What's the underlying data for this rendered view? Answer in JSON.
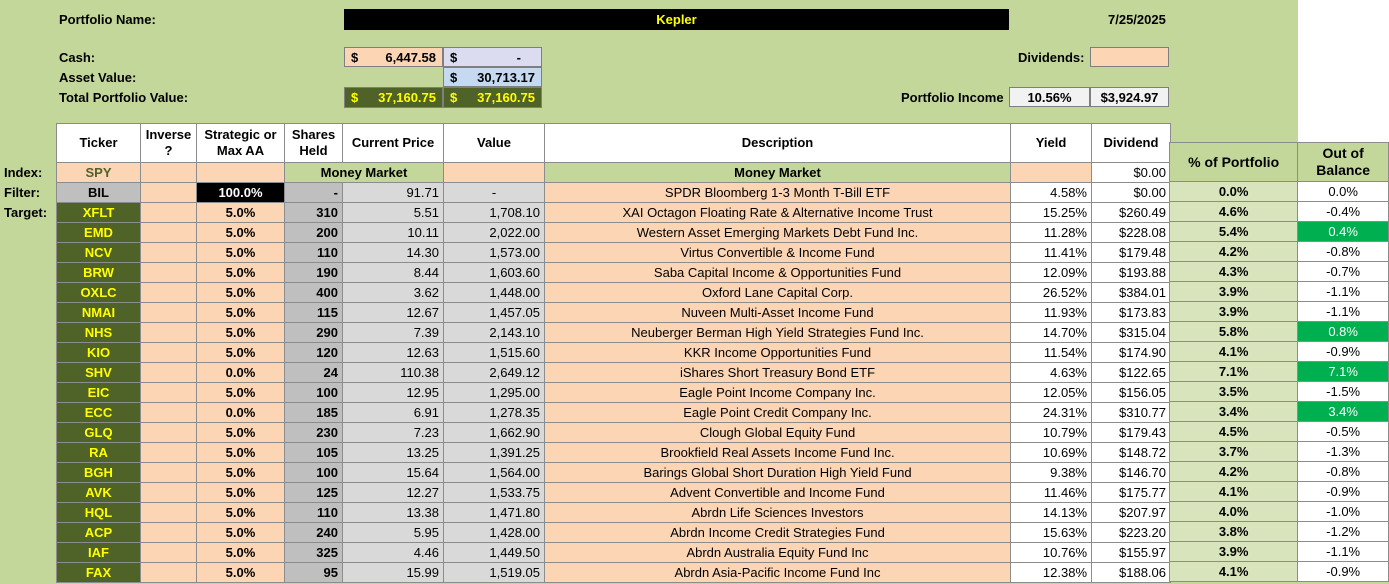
{
  "header": {
    "portfolio_name_label": "Portfolio Name:",
    "portfolio_name": "Kepler",
    "date": "7/25/2025",
    "cash_label": "Cash:",
    "cash_currency": "$",
    "cash_value": "6,447.58",
    "cash2_currency": "$",
    "cash2_value": "-",
    "asset_value_label": "Asset Value:",
    "asset_currency": "$",
    "asset_value": "30,713.17",
    "total_label": "Total Portfolio Value:",
    "total_currency": "$",
    "total_value": "37,160.75",
    "total2_currency": "$",
    "total2_value": "37,160.75",
    "dividends_label": "Dividends:",
    "dividends_value": "",
    "income_label": "Portfolio Income",
    "income_pct": "10.56%",
    "income_value": "$3,924.97"
  },
  "row_labels": {
    "index": "Index:",
    "filter": "Filter:",
    "target": "Target:"
  },
  "columns": [
    "Ticker",
    "Inverse ?",
    "Strategic or Max AA",
    "Shares Held",
    "Current Price",
    "Value",
    "Description",
    "Yield",
    "Dividend"
  ],
  "side_columns": [
    "% of Portfolio",
    "Out of Balance"
  ],
  "index_row": {
    "ticker": "SPY",
    "inverse": "",
    "aa": "",
    "shares": "Money Market",
    "price": "",
    "value": "",
    "description": "Money Market",
    "yield": "",
    "dividend": "$0.00"
  },
  "filter_row": {
    "ticker": "BIL",
    "inverse": "",
    "aa": "100.0%",
    "shares": "-",
    "price": "91.71",
    "value": "-",
    "description": "SPDR Bloomberg 1-3 Month T-Bill ETF",
    "yield": "4.58%",
    "dividend": "$0.00",
    "pct": "0.0%",
    "oob": "0.0%"
  },
  "rows": [
    {
      "ticker": "XFLT",
      "inverse": "",
      "aa": "5.0%",
      "shares": "310",
      "price": "5.51",
      "value": "1,708.10",
      "description": "XAI Octagon Floating Rate & Alternative Income Trust",
      "yield": "15.25%",
      "dividend": "$260.49",
      "pct": "4.6%",
      "oob": "-0.4%",
      "pos": false
    },
    {
      "ticker": "EMD",
      "inverse": "",
      "aa": "5.0%",
      "shares": "200",
      "price": "10.11",
      "value": "2,022.00",
      "description": "Western Asset Emerging Markets Debt Fund Inc.",
      "yield": "11.28%",
      "dividend": "$228.08",
      "pct": "5.4%",
      "oob": "0.4%",
      "pos": true
    },
    {
      "ticker": "NCV",
      "inverse": "",
      "aa": "5.0%",
      "shares": "110",
      "price": "14.30",
      "value": "1,573.00",
      "description": "Virtus Convertible & Income Fund",
      "yield": "11.41%",
      "dividend": "$179.48",
      "pct": "4.2%",
      "oob": "-0.8%",
      "pos": false
    },
    {
      "ticker": "BRW",
      "inverse": "",
      "aa": "5.0%",
      "shares": "190",
      "price": "8.44",
      "value": "1,603.60",
      "description": "Saba Capital Income & Opportunities Fund",
      "yield": "12.09%",
      "dividend": "$193.88",
      "pct": "4.3%",
      "oob": "-0.7%",
      "pos": false
    },
    {
      "ticker": "OXLC",
      "inverse": "",
      "aa": "5.0%",
      "shares": "400",
      "price": "3.62",
      "value": "1,448.00",
      "description": "Oxford Lane Capital Corp.",
      "yield": "26.52%",
      "dividend": "$384.01",
      "pct": "3.9%",
      "oob": "-1.1%",
      "pos": false
    },
    {
      "ticker": "NMAI",
      "inverse": "",
      "aa": "5.0%",
      "shares": "115",
      "price": "12.67",
      "value": "1,457.05",
      "description": "Nuveen Multi-Asset Income Fund",
      "yield": "11.93%",
      "dividend": "$173.83",
      "pct": "3.9%",
      "oob": "-1.1%",
      "pos": false
    },
    {
      "ticker": "NHS",
      "inverse": "",
      "aa": "5.0%",
      "shares": "290",
      "price": "7.39",
      "value": "2,143.10",
      "description": "Neuberger Berman High Yield Strategies Fund Inc.",
      "yield": "14.70%",
      "dividend": "$315.04",
      "pct": "5.8%",
      "oob": "0.8%",
      "pos": true
    },
    {
      "ticker": "KIO",
      "inverse": "",
      "aa": "5.0%",
      "shares": "120",
      "price": "12.63",
      "value": "1,515.60",
      "description": "KKR Income Opportunities Fund",
      "yield": "11.54%",
      "dividend": "$174.90",
      "pct": "4.1%",
      "oob": "-0.9%",
      "pos": false
    },
    {
      "ticker": "SHV",
      "inverse": "",
      "aa": "0.0%",
      "shares": "24",
      "price": "110.38",
      "value": "2,649.12",
      "description": "iShares Short Treasury Bond ETF",
      "yield": "4.63%",
      "dividend": "$122.65",
      "pct": "7.1%",
      "oob": "7.1%",
      "pos": true
    },
    {
      "ticker": "EIC",
      "inverse": "",
      "aa": "5.0%",
      "shares": "100",
      "price": "12.95",
      "value": "1,295.00",
      "description": "Eagle Point Income Company Inc.",
      "yield": "12.05%",
      "dividend": "$156.05",
      "pct": "3.5%",
      "oob": "-1.5%",
      "pos": false
    },
    {
      "ticker": "ECC",
      "inverse": "",
      "aa": "0.0%",
      "shares": "185",
      "price": "6.91",
      "value": "1,278.35",
      "description": "Eagle Point Credit Company Inc.",
      "yield": "24.31%",
      "dividend": "$310.77",
      "pct": "3.4%",
      "oob": "3.4%",
      "pos": true
    },
    {
      "ticker": "GLQ",
      "inverse": "",
      "aa": "5.0%",
      "shares": "230",
      "price": "7.23",
      "value": "1,662.90",
      "description": "Clough Global Equity Fund",
      "yield": "10.79%",
      "dividend": "$179.43",
      "pct": "4.5%",
      "oob": "-0.5%",
      "pos": false
    },
    {
      "ticker": "RA",
      "inverse": "",
      "aa": "5.0%",
      "shares": "105",
      "price": "13.25",
      "value": "1,391.25",
      "description": "Brookfield Real Assets Income Fund Inc.",
      "yield": "10.69%",
      "dividend": "$148.72",
      "pct": "3.7%",
      "oob": "-1.3%",
      "pos": false
    },
    {
      "ticker": "BGH",
      "inverse": "",
      "aa": "5.0%",
      "shares": "100",
      "price": "15.64",
      "value": "1,564.00",
      "description": "Barings Global Short Duration High Yield Fund",
      "yield": "9.38%",
      "dividend": "$146.70",
      "pct": "4.2%",
      "oob": "-0.8%",
      "pos": false
    },
    {
      "ticker": "AVK",
      "inverse": "",
      "aa": "5.0%",
      "shares": "125",
      "price": "12.27",
      "value": "1,533.75",
      "description": "Advent Convertible and Income Fund",
      "yield": "11.46%",
      "dividend": "$175.77",
      "pct": "4.1%",
      "oob": "-0.9%",
      "pos": false
    },
    {
      "ticker": "HQL",
      "inverse": "",
      "aa": "5.0%",
      "shares": "110",
      "price": "13.38",
      "value": "1,471.80",
      "description": "Abrdn Life Sciences Investors",
      "yield": "14.13%",
      "dividend": "$207.97",
      "pct": "4.0%",
      "oob": "-1.0%",
      "pos": false
    },
    {
      "ticker": "ACP",
      "inverse": "",
      "aa": "5.0%",
      "shares": "240",
      "price": "5.95",
      "value": "1,428.00",
      "description": "Abrdn Income Credit Strategies Fund",
      "yield": "15.63%",
      "dividend": "$223.20",
      "pct": "3.8%",
      "oob": "-1.2%",
      "pos": false
    },
    {
      "ticker": "IAF",
      "inverse": "",
      "aa": "5.0%",
      "shares": "325",
      "price": "4.46",
      "value": "1,449.50",
      "description": "Abrdn Australia Equity Fund Inc",
      "yield": "10.76%",
      "dividend": "$155.97",
      "pct": "3.9%",
      "oob": "-1.1%",
      "pos": false
    },
    {
      "ticker": "FAX",
      "inverse": "",
      "aa": "5.0%",
      "shares": "95",
      "price": "15.99",
      "value": "1,519.05",
      "description": "Abrdn Asia-Pacific Income Fund Inc",
      "yield": "12.38%",
      "dividend": "$188.06",
      "pct": "4.1%",
      "oob": "-0.9%",
      "pos": false
    }
  ],
  "colors": {
    "background": "#c4d79b",
    "ticker_bg": "#4f6228",
    "ticker_fg": "#ffff00",
    "peach": "#fcd5b4",
    "positive_balance": "#00b050"
  }
}
